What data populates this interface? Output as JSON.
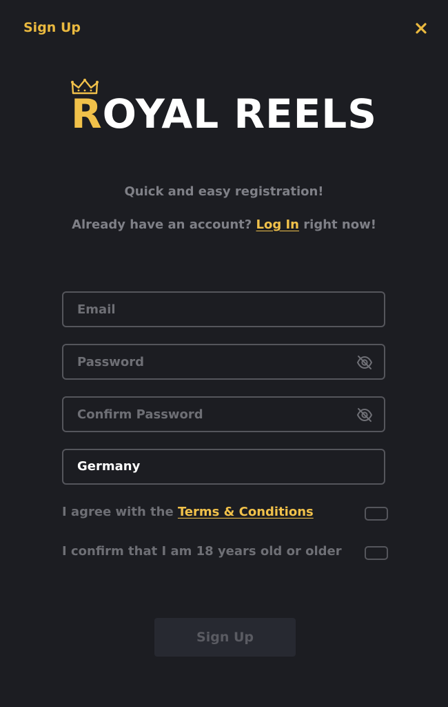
{
  "header": {
    "title": "Sign Up",
    "close_icon": "close-icon",
    "accent_color": "#eab93f"
  },
  "logo": {
    "first_letter": "R",
    "rest": "OYAL REELS",
    "crown_icon": "crown-icon"
  },
  "intro": {
    "tagline": "Quick and easy registration!",
    "login_prefix": "Already have an account?",
    "login_link": "Log In",
    "login_suffix": "right now!"
  },
  "form": {
    "email_placeholder": "Email",
    "email_value": "",
    "password_placeholder": "Password",
    "password_value": "",
    "confirm_placeholder": "Confirm Password",
    "confirm_value": "",
    "country_value": "Germany",
    "eye_icon": "eye-off-icon",
    "terms_prefix": "I agree with the",
    "terms_link": "Terms & Conditions",
    "terms_checked": false,
    "age_label": "I confirm that I am 18 years old or older",
    "age_checked": false,
    "submit_label": "Sign Up"
  }
}
